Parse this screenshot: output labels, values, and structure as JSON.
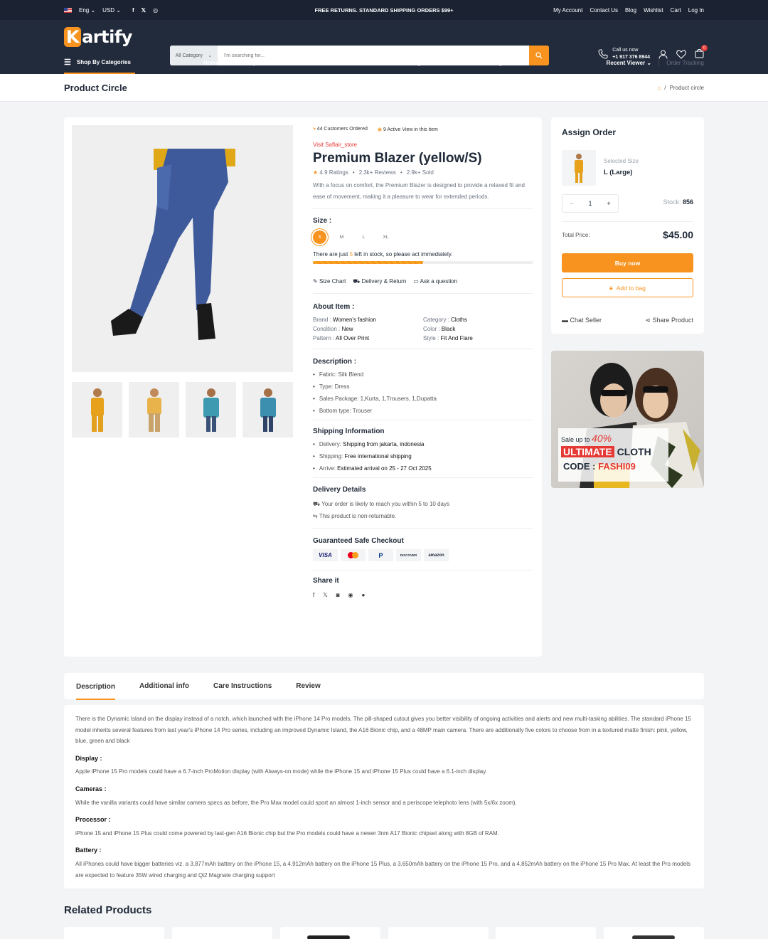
{
  "topbar": {
    "lang": "Eng",
    "currency": "USD",
    "promo": "FREE RETURNS. STANDARD SHIPPING ORDERS $99+",
    "links": [
      "My Account",
      "Contact Us",
      "Blog",
      "Wishlist",
      "Cart",
      "Log In"
    ]
  },
  "header": {
    "logo": "Kartify",
    "logo_first": "K",
    "logo_rest": "artify",
    "category": "All Category",
    "search_placeholder": "I'm searching for...",
    "call_label": "Call us now",
    "phone": "+1 917 376 8944",
    "cart_count": "0"
  },
  "nav": {
    "shop_by": "Shop By Categories",
    "menu": [
      "Home",
      "Shop",
      "Product",
      "Sales",
      "Features",
      "Pages",
      "Seller",
      "Blog"
    ],
    "recent": "Recent Viewer",
    "tracking": "Order Tracking"
  },
  "page": {
    "title": "Product Circle",
    "crumb": "Product circle"
  },
  "product": {
    "ordered": "44 Customers Ordered",
    "viewing": "9 Active View in this item",
    "store": "Visit Saflair_store",
    "name": "Premium Blazer (yellow/S)",
    "ratings": "4.9 Ratings",
    "reviews": "2.3k+ Reviews",
    "sold": "2.9k+ Sold",
    "summary": "With a focus on comfort, the Premium Blazer is designed to provide a relaxed fit and ease of movement, making it a pleasure to wear for extended periods.",
    "size_label": "Size :",
    "sizes": [
      "S",
      "M",
      "L",
      "XL"
    ],
    "stock_before": "There are just ",
    "stock_num": "5",
    "stock_after": " left in stock, so please act immediately.",
    "stock_fill": 0.5,
    "size_chart": "Size Chart",
    "delivery_return": "Delivery & Return",
    "ask": "Ask a question"
  },
  "about": {
    "title": "About Item :",
    "items": [
      [
        "Brand : ",
        "Women's fashion"
      ],
      [
        "Category : ",
        "Cloths"
      ],
      [
        "Condition : ",
        "New"
      ],
      [
        "Color : ",
        "Black"
      ],
      [
        "Pattern : ",
        "All Over Print"
      ],
      [
        "Style : ",
        "Fit And Flare"
      ]
    ]
  },
  "description": {
    "title": "Description :",
    "items": [
      "Fabric: Silk Blend",
      "Type: Dress",
      "Sales Package: 1,Kurta, 1,Trousers, 1,Dupatta",
      "Bottom type: Trouser"
    ]
  },
  "shipping": {
    "title": "Shipping Information",
    "items": [
      [
        "Delivery:",
        "Shipping from jakarta, indonesia"
      ],
      [
        "Shipping:",
        "Free international shipping"
      ],
      [
        "Arrive:",
        "Estimated arrival on 25 - 27 Oct 2025"
      ]
    ]
  },
  "delivery": {
    "title": "Delivery Details",
    "line1": "Your order is likely to reach you within 5 to 10 days",
    "line2": "This product is non-returnable."
  },
  "checkout": {
    "title": "Guaranteed Safe Checkout",
    "methods": [
      "VISA",
      "MC",
      "PayPal",
      "DISCOVER",
      "amazon"
    ]
  },
  "share": {
    "title": "Share it"
  },
  "order": {
    "title": "Assign Order",
    "selected_label": "Selected Size",
    "selected_value": "L (Large)",
    "qty": "1",
    "stock_label": "Stock:",
    "stock_value": "856",
    "total_label": "Total Price:",
    "total": "$45.00",
    "buy": "Buy now",
    "add": "Add to bag",
    "chat": "Chat Seller",
    "share": "Share Product"
  },
  "promo": {
    "sale": "Sale up to",
    "pct": "40%",
    "ultimate": "ULTIMATE",
    "cloth": "CLOTH",
    "code_label": "CODE :",
    "code": "FASHI09"
  },
  "tabs": [
    "Description",
    "Additional info",
    "Care Instructions",
    "Review"
  ],
  "details": {
    "intro": "There is the Dynamic Island on the display instead of a notch, which launched with the iPhone 14 Pro models. The pill-shaped cutout gives you better visibility of ongoing activities and alerts and new multi-tasking abilities. The standard iPhone 15 model inherits several features from last year's iPhone 14 Pro series, including an improved Dynamic Island, the A16 Bionic chip, and a 48MP main camera. There are additionally five colors to choose from in a textured matte finish: pink, yellow, blue, green and black",
    "display_h": "Display :",
    "display": "Apple iPhone 15 Pro models could have a 6.7-inch ProMotion display (with Always-on mode) while the iPhone 15 and iPhone 15 Plus could have a 6.1-inch display.",
    "cameras_h": "Cameras :",
    "cameras": "While the vanilla variants could have similar camera specs as before, the Pro Max model could sport an almost 1-inch sensor and a periscope telephoto lens (with 5x/6x zoom).",
    "processor_h": "Processor :",
    "processor": "iPhone 15 and iPhone 15 Plus could come powered by last-gen A16 Bionic chip but the Pro models could have a newer 3nm A17 Bionic chipset along with 8GB of RAM.",
    "battery_h": "Battery :",
    "battery": "All iPhones could have bigger batteries viz. a 3,877mAh battery on the iPhone 15, a 4,912mAh battery on the iPhone 15 Plus, a 3,650mAh battery on the iPhone 15 Pro, and a 4,852mAh battery on the iPhone 15 Pro Max. At least the Pro models are expected to feature 35W wired charging and Qi2 Magnate charging support"
  },
  "related": {
    "title": "Related Products"
  },
  "colors": {
    "accent": "#f7931e",
    "header": "#222b3c",
    "topbar": "#1b2333",
    "red": "#e53935"
  }
}
